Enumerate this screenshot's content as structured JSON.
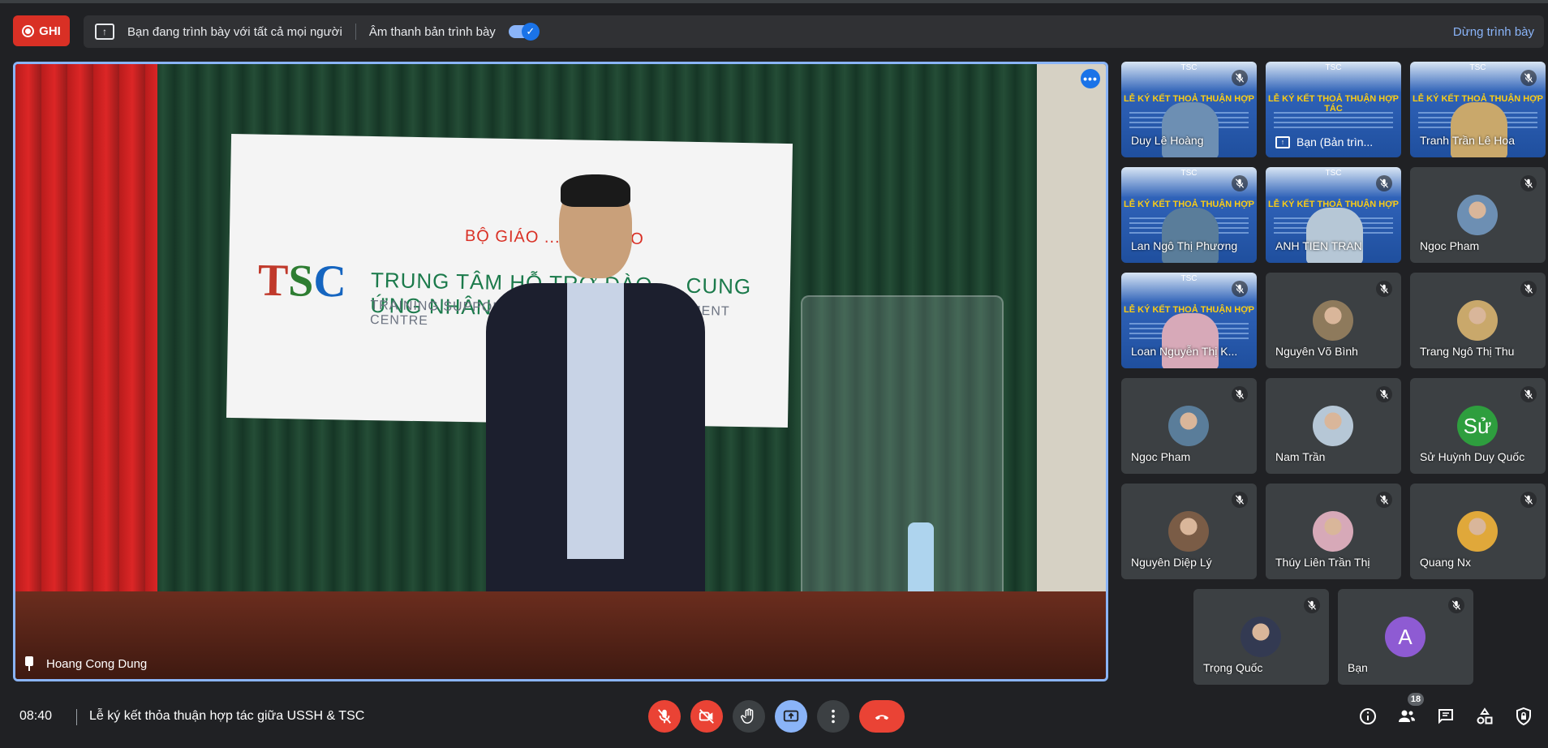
{
  "topbar": {
    "record_label": "GHI",
    "presenting_text": "Bạn đang trình bày với tất cả mọi người",
    "audio_label": "Âm thanh bản trình bày",
    "stop_presenting": "Dừng trình bày",
    "audio_toggle_on": true
  },
  "main_video": {
    "speaker": "Hoang Cong Dung",
    "banner_title": "BỘ GIÁO ... ĐÀO TẠO",
    "banner_logo": "TSC",
    "banner_line1": "TRUNG TÂM HỖ TRỢ ĐÀO ... CUNG ỨNG NHÂN LỰC",
    "banner_line2": "TRAINING SUPPORT AND HUMAN ... DEVELOPMENT CENTRE"
  },
  "slide": {
    "header": "TSC",
    "title": "LỄ KÝ KẾT THOẢ THUẬN HỢP TÁC"
  },
  "participants": [
    {
      "name": "Duy Lê Hoàng",
      "kind": "slide-cam"
    },
    {
      "name": "Bạn (Bản trìn...",
      "kind": "presentation"
    },
    {
      "name": "Tranh Trần Lê Hoa",
      "kind": "slide-cam"
    },
    {
      "name": "Lan Ngô Thị Phương",
      "kind": "slide-cam"
    },
    {
      "name": "ANH TIEN TRAN",
      "kind": "slide-cam"
    },
    {
      "name": "Ngoc Pham",
      "kind": "avatar"
    },
    {
      "name": "Loan Nguyễn Thị K...",
      "kind": "slide-cam"
    },
    {
      "name": "Nguyên Võ Bình",
      "kind": "avatar"
    },
    {
      "name": "Trang Ngô Thị Thu",
      "kind": "avatar"
    },
    {
      "name": "Ngoc Pham",
      "kind": "avatar"
    },
    {
      "name": "Nam Trần",
      "kind": "avatar"
    },
    {
      "name": "Sử Huỳnh Duy Quốc",
      "kind": "letter",
      "letter": "Sử"
    },
    {
      "name": "Nguyên Diệp Lý",
      "kind": "avatar"
    },
    {
      "name": "Thúy Liên Trần Thị",
      "kind": "avatar"
    },
    {
      "name": "Quang Nx",
      "kind": "avatar"
    },
    {
      "name": "Trọng Quốc",
      "kind": "avatar"
    },
    {
      "name": "Bạn",
      "kind": "letter",
      "letter": "A"
    }
  ],
  "bottombar": {
    "time": "08:40",
    "meeting_title": "Lễ ký kết thỏa thuận hợp tác giữa USSH & TSC",
    "people_count": "18"
  },
  "colors": {
    "background": "#202124",
    "record_red": "#d93025",
    "accent_blue": "#8ab4f8",
    "control_red": "#ea4335",
    "avatar_green": "#2e9e3e",
    "avatar_purple": "#8e5bd3"
  }
}
